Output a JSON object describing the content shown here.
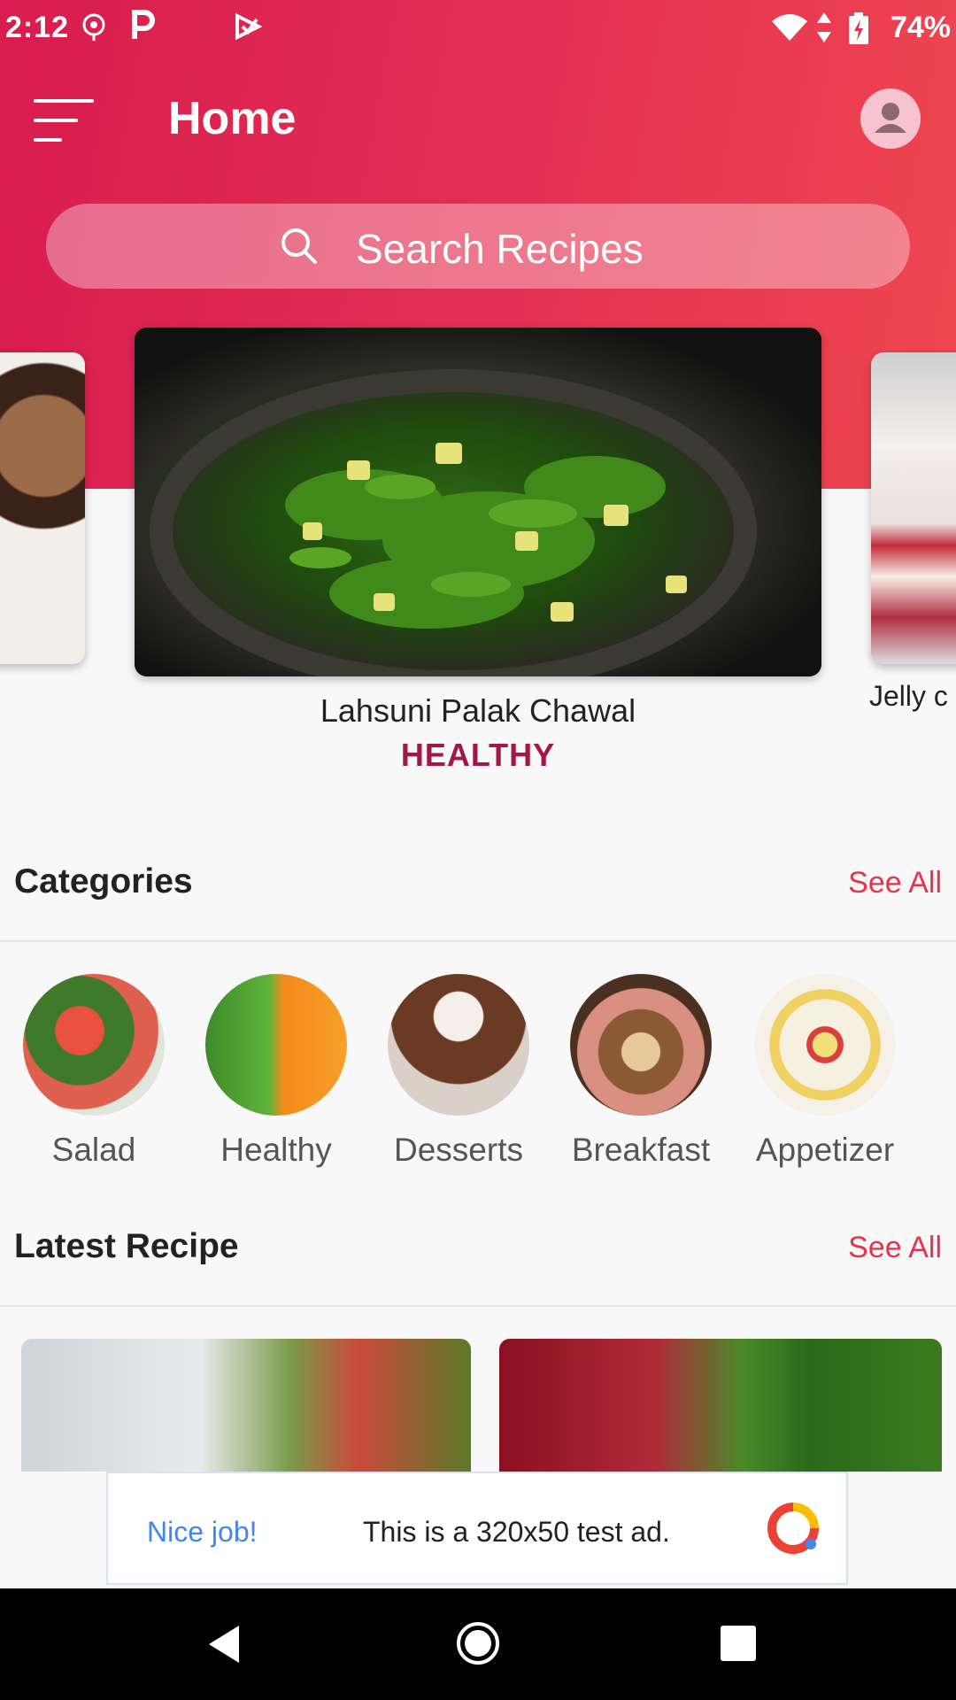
{
  "status_bar": {
    "time": "2:12",
    "battery": "74%"
  },
  "header": {
    "title": "Home"
  },
  "search": {
    "placeholder": "Search Recipes"
  },
  "carousel": {
    "main": {
      "title": "Lahsuni Palak Chawal",
      "category": "HEALTHY"
    },
    "right_partial_title": "Jelly c"
  },
  "categories": {
    "title": "Categories",
    "see_all": "See All",
    "items": [
      {
        "label": "Salad"
      },
      {
        "label": "Healthy"
      },
      {
        "label": "Desserts"
      },
      {
        "label": "Breakfast"
      },
      {
        "label": "Appetizer"
      }
    ]
  },
  "latest": {
    "title": "Latest Recipe",
    "see_all": "See All"
  },
  "ad": {
    "badge": "Nice job!",
    "text": "This is a 320x50 test ad."
  },
  "colors": {
    "accent": "#e8334a",
    "category_text": "#a0174a",
    "header_start": "#d81c4f",
    "header_end": "#f0474f"
  }
}
